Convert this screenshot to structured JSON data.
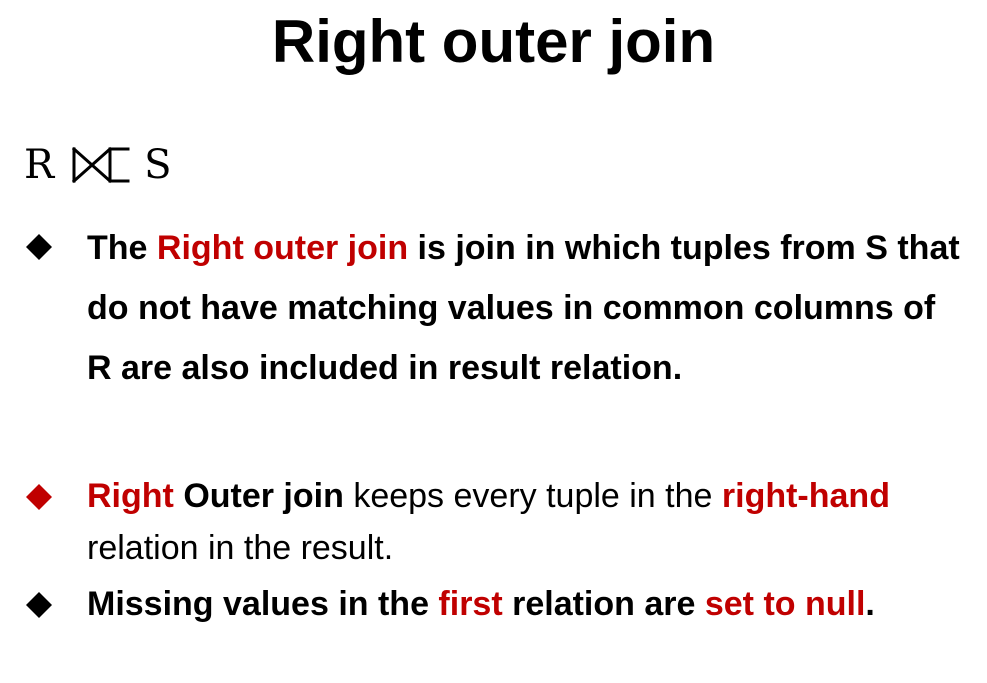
{
  "title": "Right outer join",
  "expression": {
    "left": "R",
    "operator_icon": "right-outer-join-icon",
    "right": "S"
  },
  "colors": {
    "accent": "#c00000",
    "text": "#000000",
    "background": "#ffffff"
  },
  "bullets": [
    {
      "marker_color": "#000000",
      "parts": [
        "The ",
        "Right outer join",
        " is join in which tuples from S that do not have matching values in common columns of R are also included in result relation."
      ]
    },
    {
      "marker_color": "#c00000",
      "parts": [
        "Right",
        " ",
        "Outer join",
        " keeps every tuple in the ",
        "right-hand",
        " relation in the result."
      ]
    },
    {
      "marker_color": "#000000",
      "parts": [
        "Missing values in the ",
        "first",
        " relation are ",
        "set to null",
        "."
      ]
    }
  ]
}
